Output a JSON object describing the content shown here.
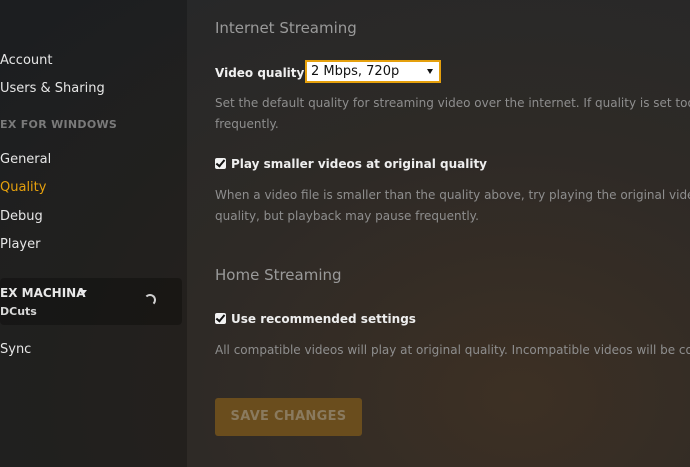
{
  "sidebar": {
    "items_top": [
      {
        "label": "Account"
      },
      {
        "label": "Users & Sharing"
      }
    ],
    "section_label": "EX FOR WINDOWS",
    "items_app": [
      {
        "label": "General"
      },
      {
        "label": "Quality"
      },
      {
        "label": "Debug"
      },
      {
        "label": "Player"
      }
    ],
    "server": {
      "name": "EX MACHINA",
      "sub": "DCuts"
    },
    "items_bottom": [
      {
        "label": "Sync"
      }
    ],
    "active_item": "Quality"
  },
  "main": {
    "internet": {
      "title": "Internet Streaming",
      "video_quality_label": "Video quality",
      "video_quality_value": "2 Mbps, 720p",
      "help_line1": "Set the default quality for streaming video over the internet. If quality is set too",
      "help_line2": "frequently.",
      "smaller_label": "Play smaller videos at original quality",
      "smaller_checked": true,
      "smaller_help_line1": "When a video file is smaller than the quality above, try playing the original video",
      "smaller_help_line2": "quality, but playback may pause frequently."
    },
    "home": {
      "title": "Home Streaming",
      "recommended_label": "Use recommended settings",
      "recommended_checked": true,
      "help": "All compatible videos will play at original quality. Incompatible videos will be co"
    },
    "save_label": "SAVE CHANGES"
  },
  "colors": {
    "accent": "#e5a00d",
    "save_button_bg": "#6a4d1d",
    "text_muted": "#8e8e8e"
  }
}
